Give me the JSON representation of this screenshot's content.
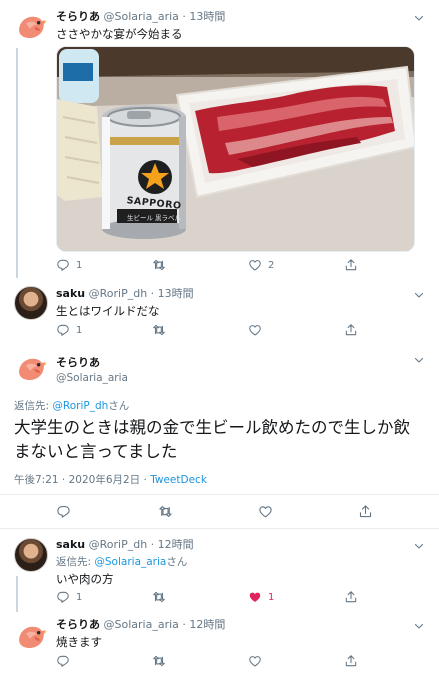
{
  "tweets": [
    {
      "name": "そらりあ",
      "handle": "@Solaria_aria",
      "time": "13時間",
      "text": "ささやかな宴が今始まる",
      "media": {
        "can_brand": "SAPPORO",
        "can_subtext": "生ビール 黒ラベル"
      },
      "counts": {
        "reply": "1",
        "retweet": "",
        "like": "2"
      }
    },
    {
      "name": "saku",
      "handle": "@RoriP_dh",
      "time": "13時間",
      "text": "生とはワイルドだな",
      "counts": {
        "reply": "1",
        "retweet": "",
        "like": ""
      }
    },
    {
      "name": "そらりあ",
      "handle": "@Solaria_aria",
      "reply_prefix": "返信先: ",
      "reply_handle": "@RoriP_dh",
      "reply_suffix": "さん",
      "text": "大学生のときは親の金で生ビール飲めたので生しか飲まないと言ってました",
      "timestamp": "午後7:21 · 2020年6月2日",
      "separator": " · ",
      "client": "TweetDeck"
    },
    {
      "name": "saku",
      "handle": "@RoriP_dh",
      "time": "12時間",
      "reply_prefix": "返信先: ",
      "reply_handle": "@Solaria_aria",
      "reply_suffix": "さん",
      "text": "いや肉の方",
      "counts": {
        "reply": "1",
        "retweet": "",
        "like": "1"
      }
    },
    {
      "name": "そらりあ",
      "handle": "@Solaria_aria",
      "time": "12時間",
      "text": "焼きます",
      "counts": {
        "reply": "",
        "retweet": "",
        "like": ""
      }
    }
  ],
  "dot": "·",
  "icons": [
    "reply-icon",
    "retweet-icon",
    "like-icon",
    "share-icon",
    "chevron-down-icon"
  ],
  "colors": {
    "link": "#1b95e0",
    "like": "#e0245e",
    "muted": "#657786",
    "line": "#ccd6dd"
  }
}
